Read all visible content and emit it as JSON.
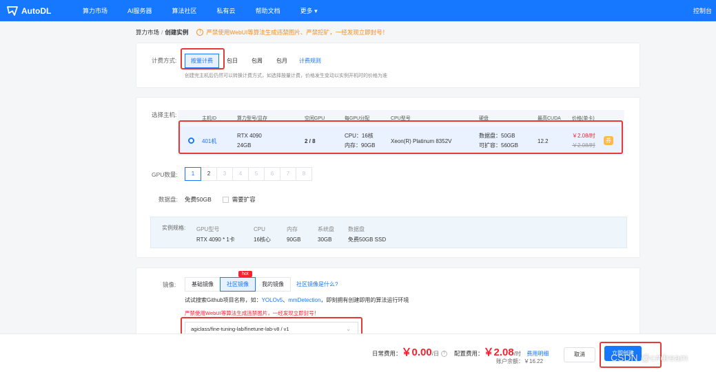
{
  "nav": {
    "brand": "AutoDL",
    "items": [
      "算力市场",
      "AI服务器",
      "算法社区",
      "私有云",
      "帮助文档",
      "更多"
    ],
    "console": "控制台"
  },
  "breadcrumb": {
    "parent": "算力市场",
    "separator": "/",
    "current": "创建实例",
    "warning": "严禁使用WebUI等算法生成违禁图片、严禁挖矿，一经发现立即封号！"
  },
  "billing": {
    "label": "计费方式:",
    "options": [
      "按量计费",
      "包日",
      "包周",
      "包月"
    ],
    "selected": "按量计费",
    "rules_link": "计费规则",
    "note": "创建完主机后仍然可以转换计费方式，如选择按量计费，价格发生变动以实例开机时的价格为准"
  },
  "host": {
    "label": "选择主机:",
    "columns": [
      "主机ID",
      "算力型号/显存",
      "空闲GPU",
      "每GPU分配",
      "CPU型号",
      "硬盘",
      "最高CUDA",
      "价格(单卡)"
    ],
    "row": {
      "id": "401机",
      "gpu_model": "RTX 4090",
      "vram": "24GB",
      "free_gpu": "2 / 8",
      "cpu_alloc": "CPU：16核",
      "mem_alloc": "内存：90GB",
      "cpu_model": "Xeon(R) Platinum 8352V",
      "data_disk": "数据盘：50GB",
      "expandable": "可扩容：560GB",
      "cuda": "12.2",
      "price": "￥2.08/时",
      "original_price": "￥2.08/时"
    }
  },
  "gpu_count": {
    "label": "GPU数量:",
    "options": [
      "1",
      "2",
      "3",
      "4",
      "5",
      "6",
      "7",
      "8"
    ],
    "selected": "1",
    "max_available": 2
  },
  "disk": {
    "label": "数据盘:",
    "free": "免费50GB",
    "expand_label": "需要扩容"
  },
  "spec": {
    "label": "实例规格:",
    "headers": [
      "GPU型号",
      "CPU",
      "内存",
      "系统盘",
      "数据盘"
    ],
    "values": [
      "RTX 4090 * 1卡",
      "16核心",
      "90GB",
      "30GB",
      "免费50GB SSD"
    ]
  },
  "image": {
    "label": "镜像:",
    "tabs": [
      "基础镜像",
      "社区镜像",
      "我的镜像"
    ],
    "selected": "社区镜像",
    "hot_badge": "hot",
    "what_link": "社区镜像是什么?",
    "hint_prefix": "试试搜索Github项目名称，如：",
    "hint_ex1": "YOLOv5",
    "hint_sep": "、",
    "hint_ex2": "mmDetection",
    "hint_suffix": "，即刻拥有创建即用的算法运行环境",
    "warning": "严禁使用WebUI等算法生成违禁图片，一经发现立即封号！",
    "selected_image": "agiclass/fine-tuning-lab/finetune-lab-v8 / v1"
  },
  "footer": {
    "daily_label": "日常费用：",
    "daily_price": "￥0.00",
    "daily_unit": "/日",
    "config_label": "配置费用：",
    "config_price": "￥2.08",
    "config_unit": "/时",
    "fee_detail": "费用明细",
    "balance": "账户余额：￥16.22",
    "cancel": "取消",
    "create": "立即创建"
  },
  "watermark": "CSDN @c#dream"
}
